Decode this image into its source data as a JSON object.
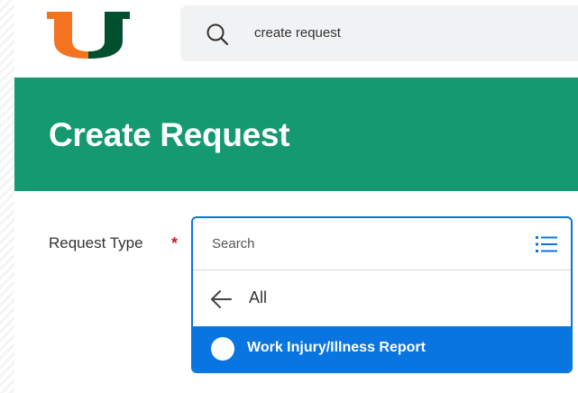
{
  "topbar": {
    "logo": "university-u-logo",
    "search_value": "create request",
    "search_icon": "search-icon"
  },
  "header": {
    "title": "Create Request"
  },
  "form": {
    "field_label": "Request Type",
    "required_marker": "*",
    "dropdown": {
      "placeholder": "Search",
      "list_icon": "list-icon",
      "back_label": "All",
      "options": [
        {
          "label": "Work Injury/Illness Report",
          "selected": true
        }
      ]
    }
  },
  "colors": {
    "header_green": "#159a70",
    "accent_blue": "#0875e1",
    "required_red": "#d11f1f",
    "logo_orange": "#f47321",
    "logo_green": "#005030"
  }
}
